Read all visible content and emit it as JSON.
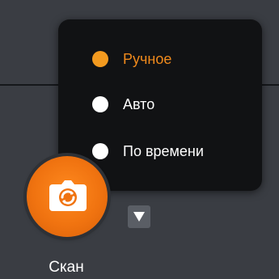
{
  "top_hint": "",
  "menu": {
    "options": [
      {
        "label": "Ручное",
        "selected": true
      },
      {
        "label": "Авто",
        "selected": false
      },
      {
        "label": "По времени",
        "selected": false
      }
    ]
  },
  "scan": {
    "label": "Скан",
    "icon": "camera-icon",
    "accent_color": "#f07310"
  },
  "dropdown": {
    "icon": "triangle-down-icon"
  }
}
